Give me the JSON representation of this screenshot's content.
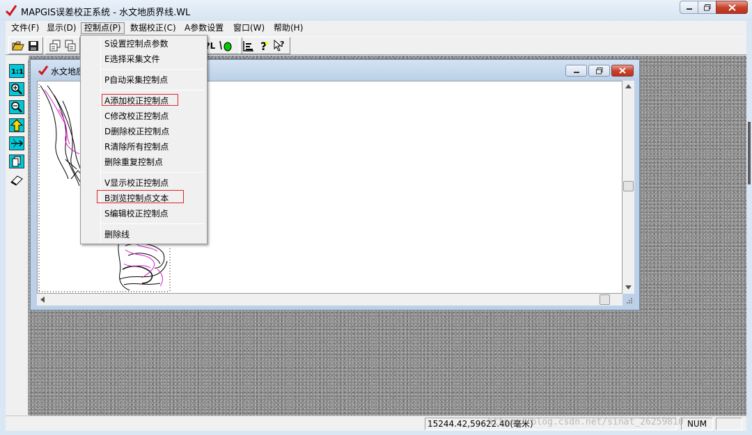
{
  "app": {
    "title": "MAPGIS误差校正系统 - 水文地质界线.WL"
  },
  "menubar": {
    "items": [
      {
        "label": "文件(F)"
      },
      {
        "label": "显示(D)"
      },
      {
        "label": "控制点(P)",
        "active": true
      },
      {
        "label": "数据校正(C)"
      },
      {
        "label": "A参数设置"
      },
      {
        "label": "窗口(W)"
      },
      {
        "label": "帮助(H)"
      }
    ]
  },
  "toolbar": {
    "visible_fragment": "?L"
  },
  "dropdown": {
    "items": [
      {
        "label": "S设置控制点参数"
      },
      {
        "label": "E选择采集文件"
      },
      {
        "label": "P自动采集控制点"
      },
      {
        "label": "A添加校正控制点",
        "highlighted": true
      },
      {
        "label": "C修改校正控制点"
      },
      {
        "label": "D删除校正控制点"
      },
      {
        "label": "R清除所有控制点"
      },
      {
        "label": "删除重复控制点"
      },
      {
        "label": "V显示校正控制点"
      },
      {
        "label": "B浏览控制点文本",
        "highlighted": true
      },
      {
        "label": "S编辑校正控制点"
      },
      {
        "label": "删除线"
      }
    ]
  },
  "child_window": {
    "title": "水文地质界线.WL"
  },
  "statusbar": {
    "coordinates": "15244.42,59622.40(毫米)",
    "num": "NUM"
  },
  "watermark": "https://blog.csdn.net/sinat_26259810",
  "colors": {
    "accent_red": "#e0252b",
    "title_check": "#d0161b",
    "map_magenta": "#d818c8"
  }
}
